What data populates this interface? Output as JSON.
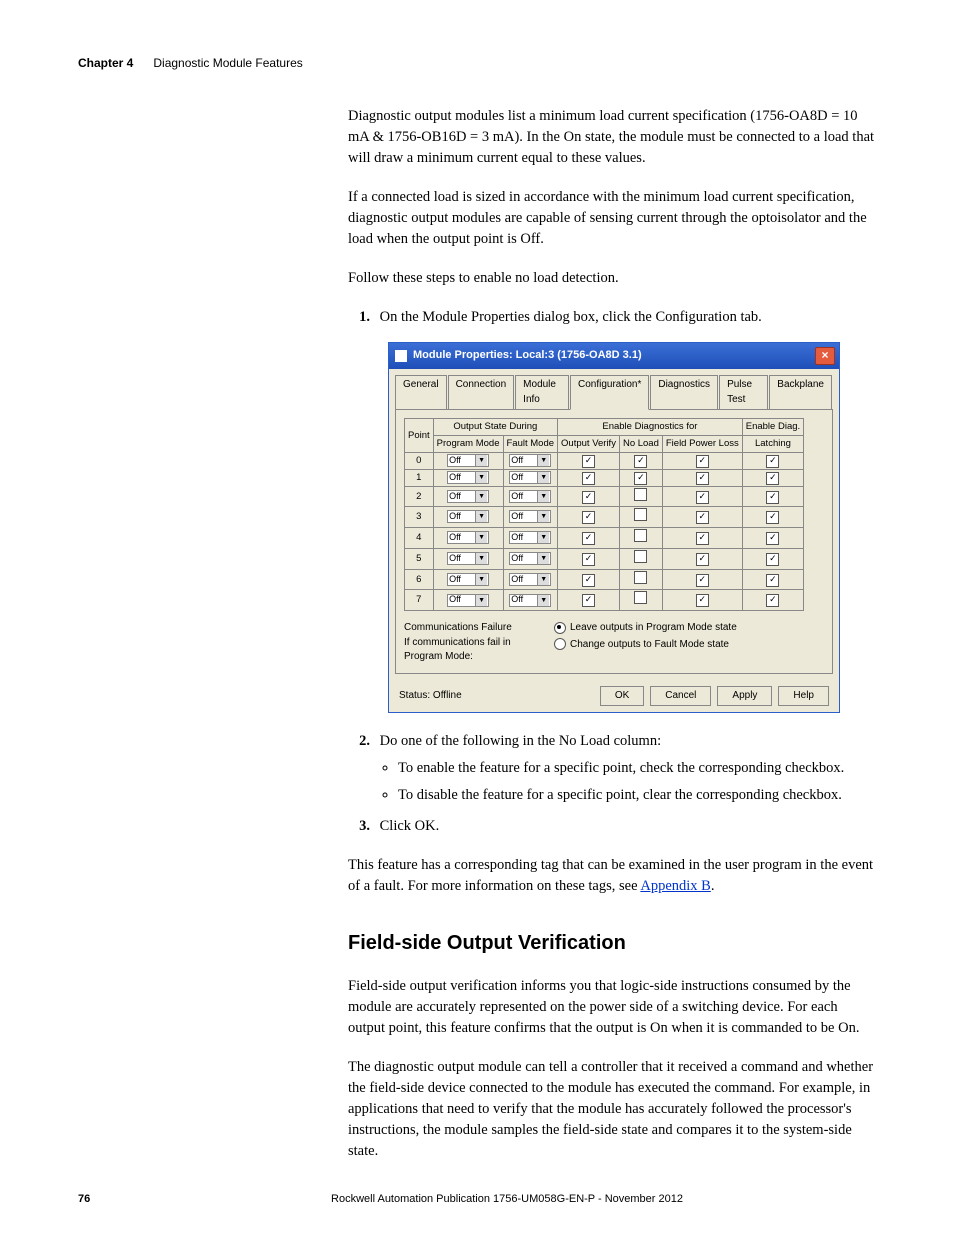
{
  "header": {
    "chapter": "Chapter 4",
    "title": "Diagnostic Module Features"
  },
  "para1": "Diagnostic output modules list a minimum load current specification (1756-OA8D = 10 mA & 1756-OB16D = 3 mA). In the On state, the module must be connected to a load that will draw a minimum current equal to these values.",
  "para2": "If a connected load is sized in accordance with the minimum load current specification, diagnostic output modules are capable of sensing current through the optoisolator and the load when the output point is Off.",
  "para3": "Follow these steps to enable no load detection.",
  "step1": "On the Module Properties dialog box, click the Configuration tab.",
  "dialog": {
    "title": "Module Properties: Local:3 (1756-OA8D 3.1)",
    "tabs": [
      "General",
      "Connection",
      "Module Info",
      "Configuration*",
      "Diagnostics",
      "Pulse Test",
      "Backplane"
    ],
    "group1": "Output State During",
    "group2": "Enable Diagnostics for",
    "group3": "Enable Diag.",
    "cols": [
      "Point",
      "Program Mode",
      "Fault Mode",
      "Output Verify",
      "No Load",
      "Field Power Loss",
      "Latching"
    ],
    "rows": [
      {
        "pt": "0",
        "pm": "Off",
        "fm": "Off",
        "ov": true,
        "nl": true,
        "fpl": true,
        "lat": true
      },
      {
        "pt": "1",
        "pm": "Off",
        "fm": "Off",
        "ov": true,
        "nl": true,
        "fpl": true,
        "lat": true
      },
      {
        "pt": "2",
        "pm": "Off",
        "fm": "Off",
        "ov": true,
        "nl": false,
        "fpl": true,
        "lat": true
      },
      {
        "pt": "3",
        "pm": "Off",
        "fm": "Off",
        "ov": true,
        "nl": false,
        "fpl": true,
        "lat": true
      },
      {
        "pt": "4",
        "pm": "Off",
        "fm": "Off",
        "ov": true,
        "nl": false,
        "fpl": true,
        "lat": true
      },
      {
        "pt": "5",
        "pm": "Off",
        "fm": "Off",
        "ov": true,
        "nl": false,
        "fpl": true,
        "lat": true
      },
      {
        "pt": "6",
        "pm": "Off",
        "fm": "Off",
        "ov": true,
        "nl": false,
        "fpl": true,
        "lat": true
      },
      {
        "pt": "7",
        "pm": "Off",
        "fm": "Off",
        "ov": true,
        "nl": false,
        "fpl": true,
        "lat": true
      }
    ],
    "comm_label1": "Communications Failure",
    "comm_label2": "If communications fail in",
    "comm_label3": "Program Mode:",
    "radio1": "Leave outputs in Program Mode state",
    "radio2": "Change outputs to Fault Mode state",
    "status_label": "Status:",
    "status_value": "Offline",
    "buttons": [
      "OK",
      "Cancel",
      "Apply",
      "Help"
    ]
  },
  "step2": "Do one of the following in the No Load column:",
  "bullet1": "To enable the feature for a specific point, check the corresponding checkbox.",
  "bullet2": "To disable the feature for a specific point, clear the corresponding checkbox.",
  "step3": "Click OK.",
  "para4a": "This feature has a corresponding tag that can be examined in the user program in the event of a fault. For more information on these tags, see ",
  "appendix_link": "Appendix B",
  "para4b": ".",
  "section_title": "Field-side Output Verification",
  "para5": "Field-side output verification informs you that logic-side instructions consumed by the module are accurately represented on the power side of a switching device. For each output point, this feature confirms that the output is On when it is commanded to be On.",
  "para6": "The diagnostic output module can tell a controller that it received a command and whether the field-side device connected to the module has executed the command. For example, in applications that need to verify that the module has accurately followed the processor's instructions, the module samples the field-side state and compares it to the system-side state.",
  "footer": {
    "page": "76",
    "pub": "Rockwell Automation Publication 1756-UM058G-EN-P - November 2012"
  }
}
